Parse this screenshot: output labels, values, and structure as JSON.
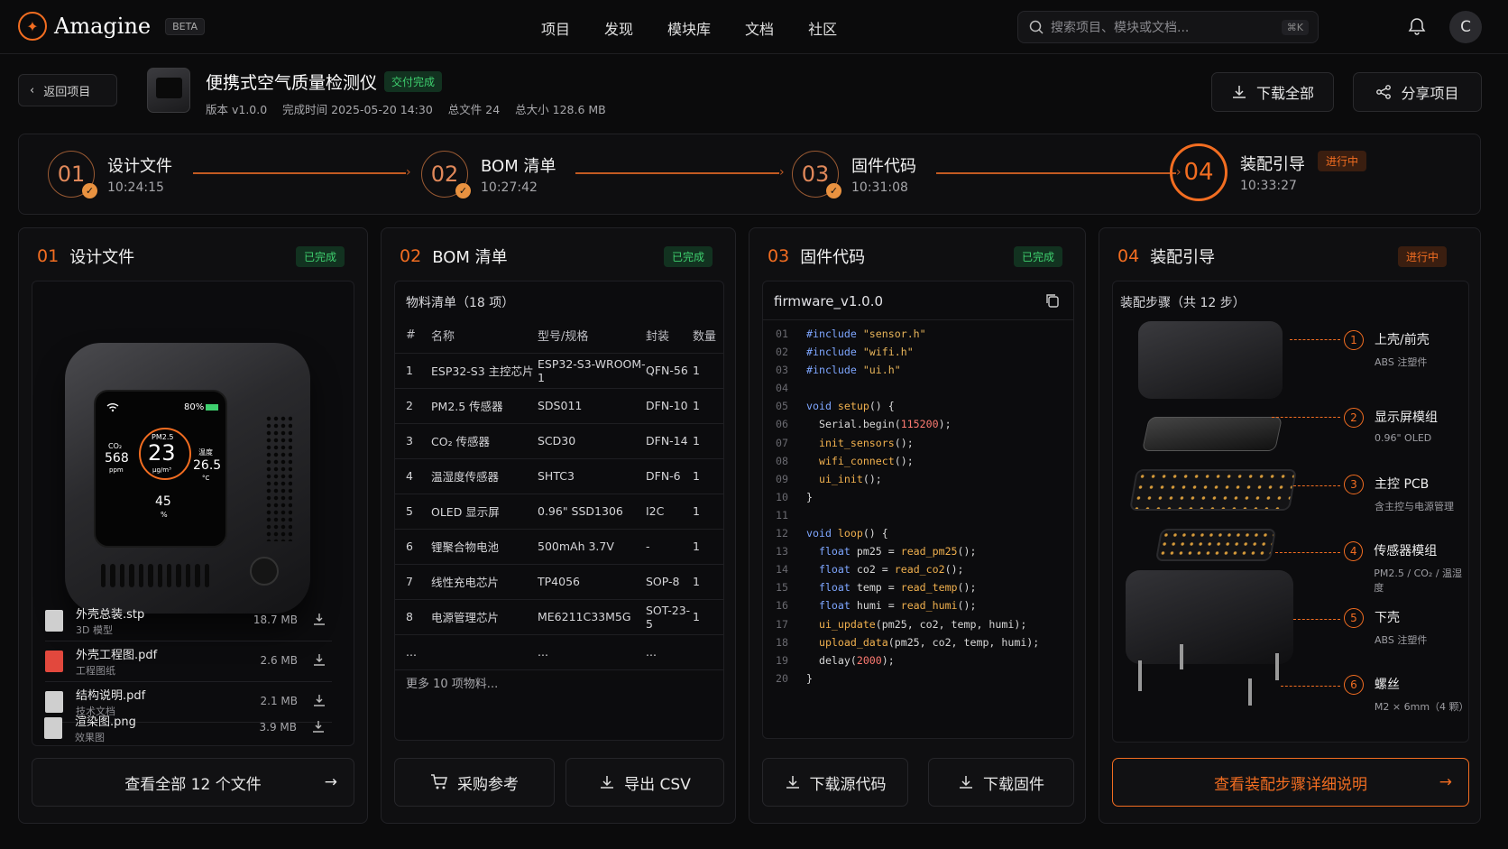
{
  "app": {
    "name": "Amagine",
    "beta": "BETA",
    "logo_glyph": "✦",
    "avatar": "C",
    "accent": "#f26d21"
  },
  "nav": [
    "项目",
    "发现",
    "模块库",
    "文档",
    "社区"
  ],
  "search": {
    "placeholder": "搜索项目、模块或文档...",
    "shortcut": "⌘K"
  },
  "project": {
    "back": "返回项目",
    "title": "便携式空气质量检测仪",
    "status": "交付完成",
    "version": "版本  v1.0.0",
    "completed": "完成时间  2025-05-20 14:30",
    "files": "总文件  24",
    "size": "总大小  128.6 MB",
    "download_all": "下载全部",
    "share": "分享项目"
  },
  "steps": [
    {
      "num": "01",
      "name": "设计文件",
      "time": "10:24:15",
      "done": true
    },
    {
      "num": "02",
      "name": "BOM 清单",
      "time": "10:27:42",
      "done": true
    },
    {
      "num": "03",
      "name": "固件代码",
      "time": "10:31:08",
      "done": true
    },
    {
      "num": "04",
      "name": "装配引导",
      "time": "10:33:27",
      "done": false,
      "badge": "进行中"
    }
  ],
  "design": {
    "num": "01",
    "title": "设计文件",
    "badge": "已完成",
    "device": {
      "battery": "80%",
      "pm_label": "PM2.5",
      "pm_value": "23",
      "pm_unit": "μg/m³",
      "co2_label": "CO₂",
      "co2_value": "568",
      "co2_unit": "ppm",
      "temp_label": "温度",
      "temp_value": "26.5",
      "temp_unit": "°C",
      "hum_value": "45",
      "hum_unit": "%"
    },
    "files": [
      {
        "name": "外壳总装.stp",
        "type": "3D 模型",
        "size": "18.7 MB",
        "icon": "3d-file-icon",
        "color": "#cfcfcf"
      },
      {
        "name": "外壳工程图.pdf",
        "type": "工程图纸",
        "size": "2.6 MB",
        "icon": "pdf-file-icon",
        "color": "#e2483d"
      },
      {
        "name": "结构说明.pdf",
        "type": "技术文档",
        "size": "2.1 MB",
        "icon": "doc-file-icon",
        "color": "#cfcfcf"
      },
      {
        "name": "渲染图.png",
        "type": "效果图",
        "size": "3.9 MB",
        "icon": "image-file-icon",
        "color": "#cfcfcf"
      }
    ],
    "view_all": "查看全部 12 个文件"
  },
  "bom": {
    "num": "02",
    "title": "BOM 清单",
    "badge": "已完成",
    "subtitle": "物料清单（18 项）",
    "headers": [
      "#",
      "名称",
      "型号/规格",
      "封装",
      "数量"
    ],
    "rows": [
      [
        "1",
        "ESP32-S3 主控芯片",
        "ESP32-S3-WROOM-1",
        "QFN-56",
        "1"
      ],
      [
        "2",
        "PM2.5 传感器",
        "SDS011",
        "DFN-10",
        "1"
      ],
      [
        "3",
        "CO₂ 传感器",
        "SCD30",
        "DFN-14",
        "1"
      ],
      [
        "4",
        "温湿度传感器",
        "SHTC3",
        "DFN-6",
        "1"
      ],
      [
        "5",
        "OLED 显示屏",
        "0.96\" SSD1306",
        "I2C",
        "1"
      ],
      [
        "6",
        "锂聚合物电池",
        "500mAh 3.7V",
        "-",
        "1"
      ],
      [
        "7",
        "线性充电芯片",
        "TP4056",
        "SOP-8",
        "1"
      ],
      [
        "8",
        "电源管理芯片",
        "ME6211C33M5G",
        "SOT-23-5",
        "1"
      ],
      [
        "...",
        "",
        "...",
        "...",
        ""
      ]
    ],
    "more": "更多 10 项物料...",
    "purchase": "采购参考",
    "export": "导出 CSV"
  },
  "firmware": {
    "num": "03",
    "title": "固件代码",
    "badge": "已完成",
    "filename": "firmware_v1.0.0",
    "download_source": "下载源代码",
    "download_fw": "下载固件"
  },
  "assembly": {
    "num": "04",
    "title": "装配引导",
    "badge": "进行中",
    "subtitle": "装配步骤（共 12 步）",
    "parts": [
      {
        "n": "1",
        "name": "上壳/前壳",
        "sub": "ABS 注塑件"
      },
      {
        "n": "2",
        "name": "显示屏模组",
        "sub": "0.96\" OLED"
      },
      {
        "n": "3",
        "name": "主控 PCB",
        "sub": "含主控与电源管理"
      },
      {
        "n": "4",
        "name": "传感器模组",
        "sub": "PM2.5 / CO₂ / 温湿度"
      },
      {
        "n": "5",
        "name": "下壳",
        "sub": "ABS 注塑件"
      },
      {
        "n": "6",
        "name": "螺丝",
        "sub": "M2 × 6mm（4 颗）"
      }
    ],
    "detail_button": "查看装配步骤详细说明"
  }
}
